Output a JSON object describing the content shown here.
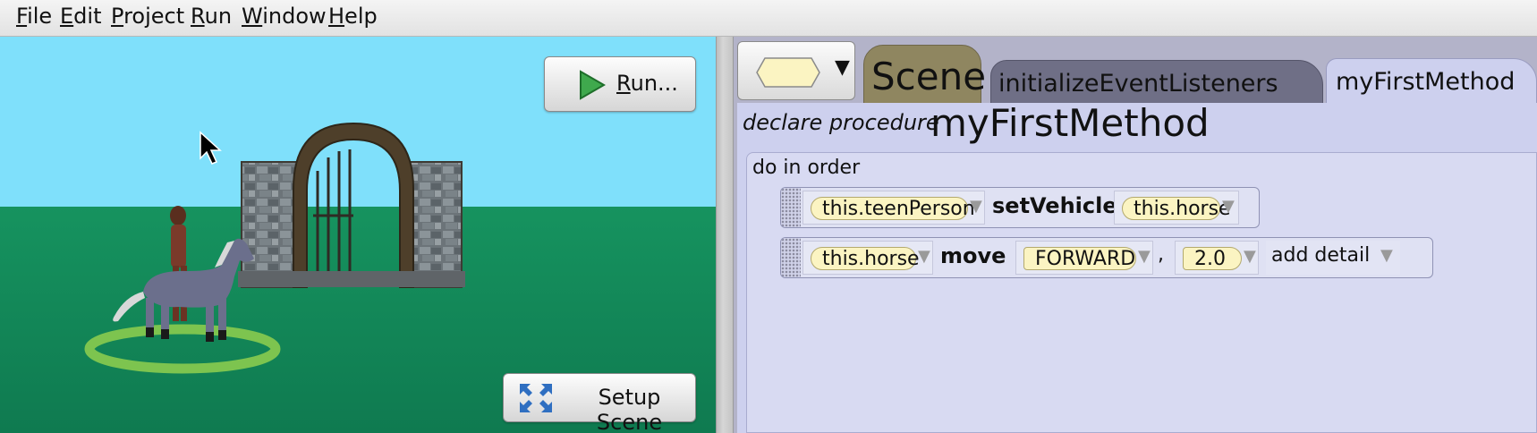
{
  "menu": {
    "items": [
      {
        "key": "F",
        "rest": "ile"
      },
      {
        "key": "E",
        "rest": "dit"
      },
      {
        "key": "P",
        "rest": "roject"
      },
      {
        "key": "R",
        "rest": "un"
      },
      {
        "key": "W",
        "rest": "indow"
      },
      {
        "key": "H",
        "rest": "elp"
      }
    ]
  },
  "scene_view": {
    "run_key": "R",
    "run_rest": "un...",
    "setup_label": "Setup Scene",
    "colors": {
      "sky": "#7fe0fb",
      "ground": "#14855a",
      "button_icon": "#3fa94d"
    }
  },
  "editor": {
    "tabs": [
      {
        "label": "Scene"
      },
      {
        "label": "initializeEventListeners"
      },
      {
        "label": "myFirstMethod"
      }
    ],
    "declare_label": "declare procedure",
    "method_name": "myFirstMethod",
    "do_in_order_label": "do in order",
    "statements": [
      {
        "target": "this.teenPerson",
        "method": "setVehicle",
        "arg": "this.horse"
      },
      {
        "target": "this.horse",
        "method": "move",
        "arg": "FORWARD",
        "separator": ",",
        "amount": "2.0",
        "detail": "add detail"
      }
    ],
    "colors": {
      "scene_tab": "#8f8660",
      "inactive_tab": "#6f6f86",
      "active_tab": "#cdd0ee",
      "pill": "#fbf4c2"
    }
  }
}
